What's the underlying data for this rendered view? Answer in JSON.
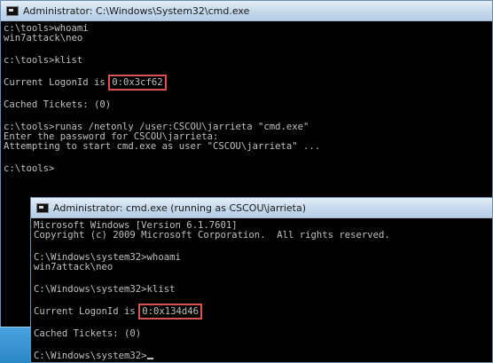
{
  "window_back": {
    "title": "Administrator: C:\\Windows\\System32\\cmd.exe",
    "lines": [
      "c:\\tools>whoami",
      "win7attack\\neo",
      "",
      "c:\\tools>klist",
      "",
      "Current LogonId is ",
      "",
      "Cached Tickets: (0)",
      "",
      "c:\\tools>runas /netonly /user:CSCOU\\jarrieta \"cmd.exe\"",
      "Enter the password for CSCOU\\jarrieta:",
      "Attempting to start cmd.exe as user \"CSCOU\\jarrieta\" ...",
      "",
      "c:\\tools>"
    ],
    "logon_id": "0:0x3cf62"
  },
  "window_front": {
    "title": "Administrator: cmd.exe (running as CSCOU\\jarrieta)",
    "lines": [
      "Microsoft Windows [Version 6.1.7601]",
      "Copyright (c) 2009 Microsoft Corporation.  All rights reserved.",
      "",
      "C:\\Windows\\system32>whoami",
      "win7attack\\neo",
      "",
      "C:\\Windows\\system32>klist",
      "",
      "Current LogonId is ",
      "",
      "Cached Tickets: (0)",
      "",
      "C:\\Windows\\system32>"
    ],
    "logon_id": "0:0x134d46"
  },
  "colors": {
    "console_bg": "#000000",
    "console_text": "#c0c0c0",
    "highlight_box": "#d9534f"
  },
  "icons": {
    "window_icon": "cmd-icon"
  }
}
